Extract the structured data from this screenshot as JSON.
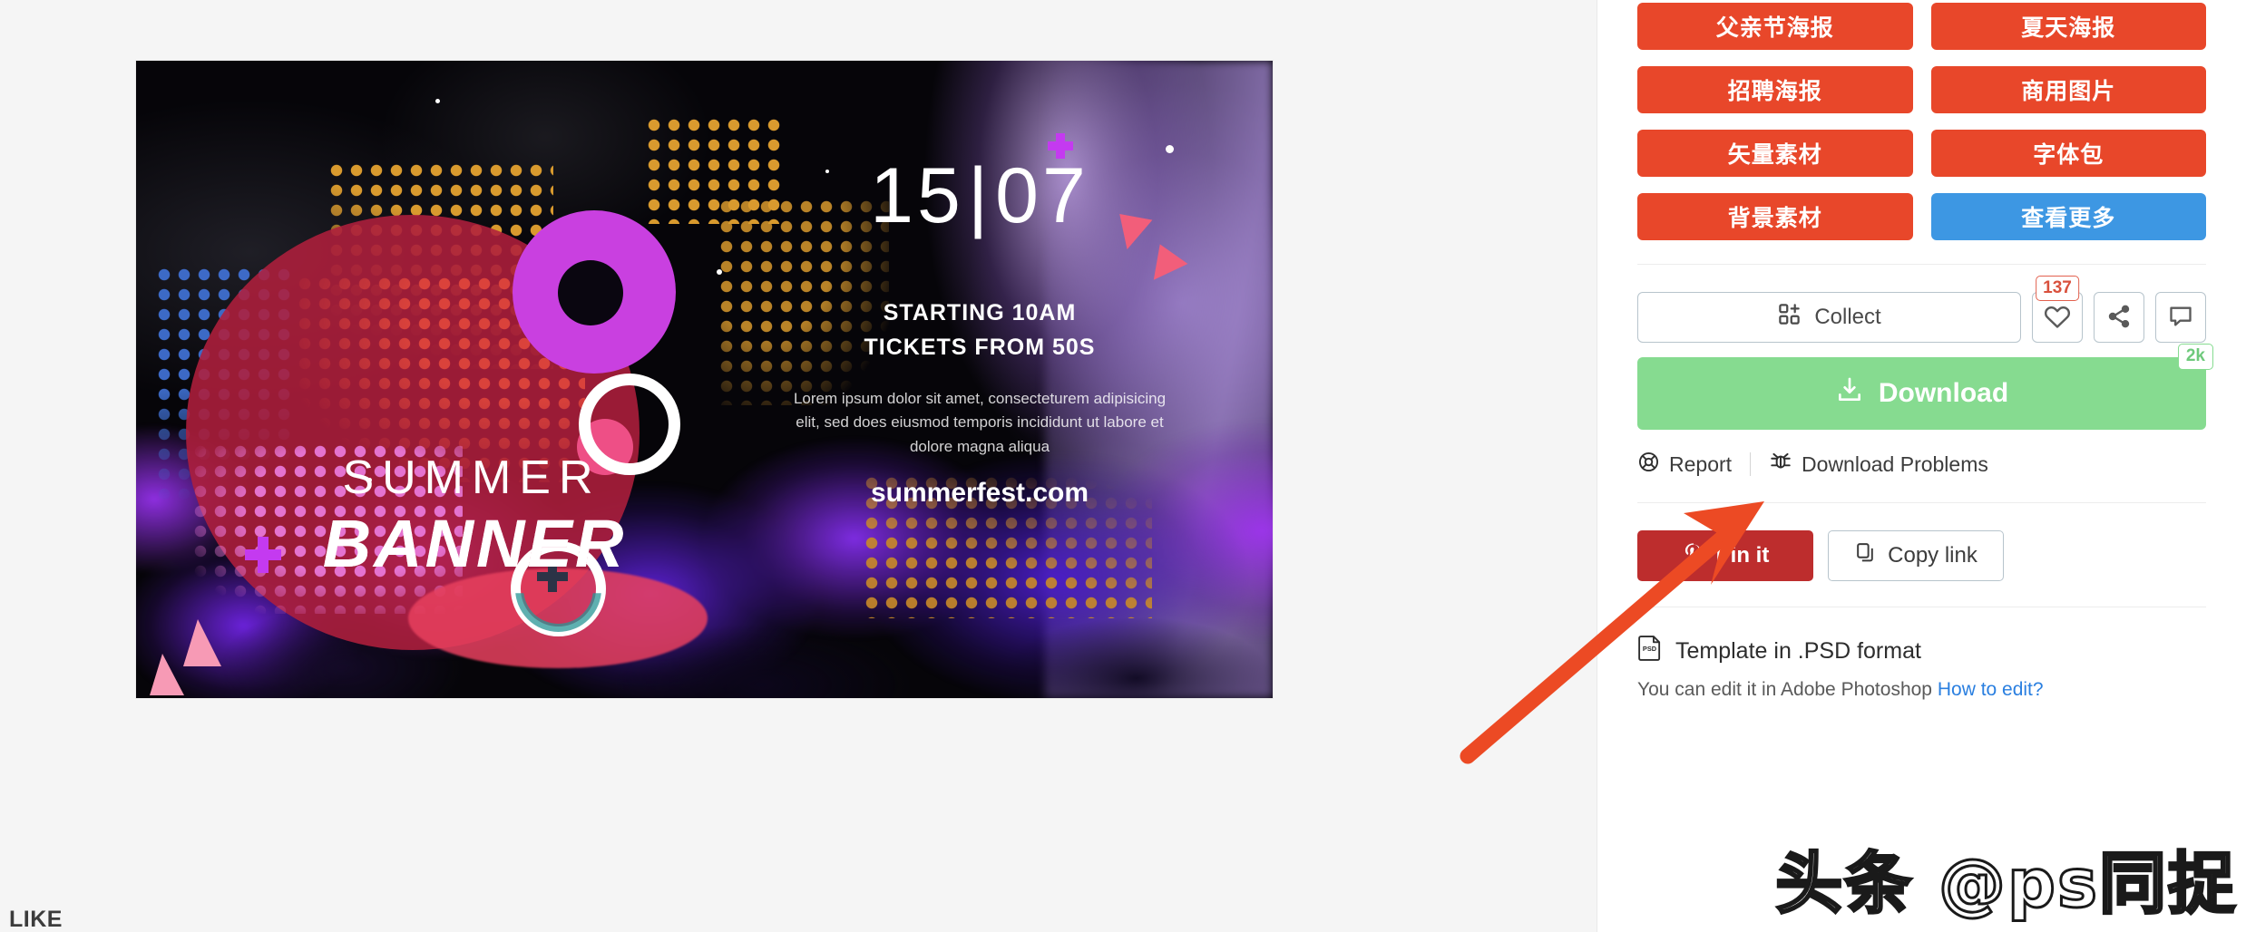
{
  "preview": {
    "banner": {
      "title_line1": "SUMMER",
      "title_line2": "BANNER",
      "date_day": "15",
      "date_sep": "|",
      "date_month": "07",
      "info_line1": "STARTING 10AM",
      "info_line2": "TICKETS FROM 50S",
      "lorem": "Lorem ipsum dolor sit amet, consecteturem adipisicing elit, sed does eiusmod temporis incididunt ut labore et dolore magna aliqua",
      "website": "summerfest.com"
    },
    "like_label": "LIKE"
  },
  "sidebar": {
    "tags": [
      {
        "label": "父亲节海报",
        "style": "orange"
      },
      {
        "label": "夏天海报",
        "style": "orange"
      },
      {
        "label": "招聘海报",
        "style": "orange"
      },
      {
        "label": "商用图片",
        "style": "orange"
      },
      {
        "label": "矢量素材",
        "style": "orange"
      },
      {
        "label": "字体包",
        "style": "orange"
      },
      {
        "label": "背景素材",
        "style": "orange"
      },
      {
        "label": "查看更多",
        "style": "blue"
      }
    ],
    "actions": {
      "collect_label": "Collect",
      "like_count": "137",
      "download_label": "Download",
      "download_count": "2k"
    },
    "meta": {
      "report_label": "Report",
      "download_problems_label": "Download Problems"
    },
    "share": {
      "pin_label": "Pin it",
      "copy_label": "Copy link"
    },
    "psd": {
      "title": "Template in .PSD format",
      "subtitle": "You can edit it in Adobe Photoshop",
      "link": "How to edit?"
    }
  },
  "watermark": {
    "text": "头条 @ps同捉"
  },
  "colors": {
    "tag_orange": "#e8472a",
    "tag_blue": "#3d97e3",
    "download_green": "#86db90",
    "pin_red": "#bd2d2d",
    "badge_red": "#d9513d",
    "link_blue": "#2a7fe0",
    "annotation_arrow": "#ec4a24"
  }
}
